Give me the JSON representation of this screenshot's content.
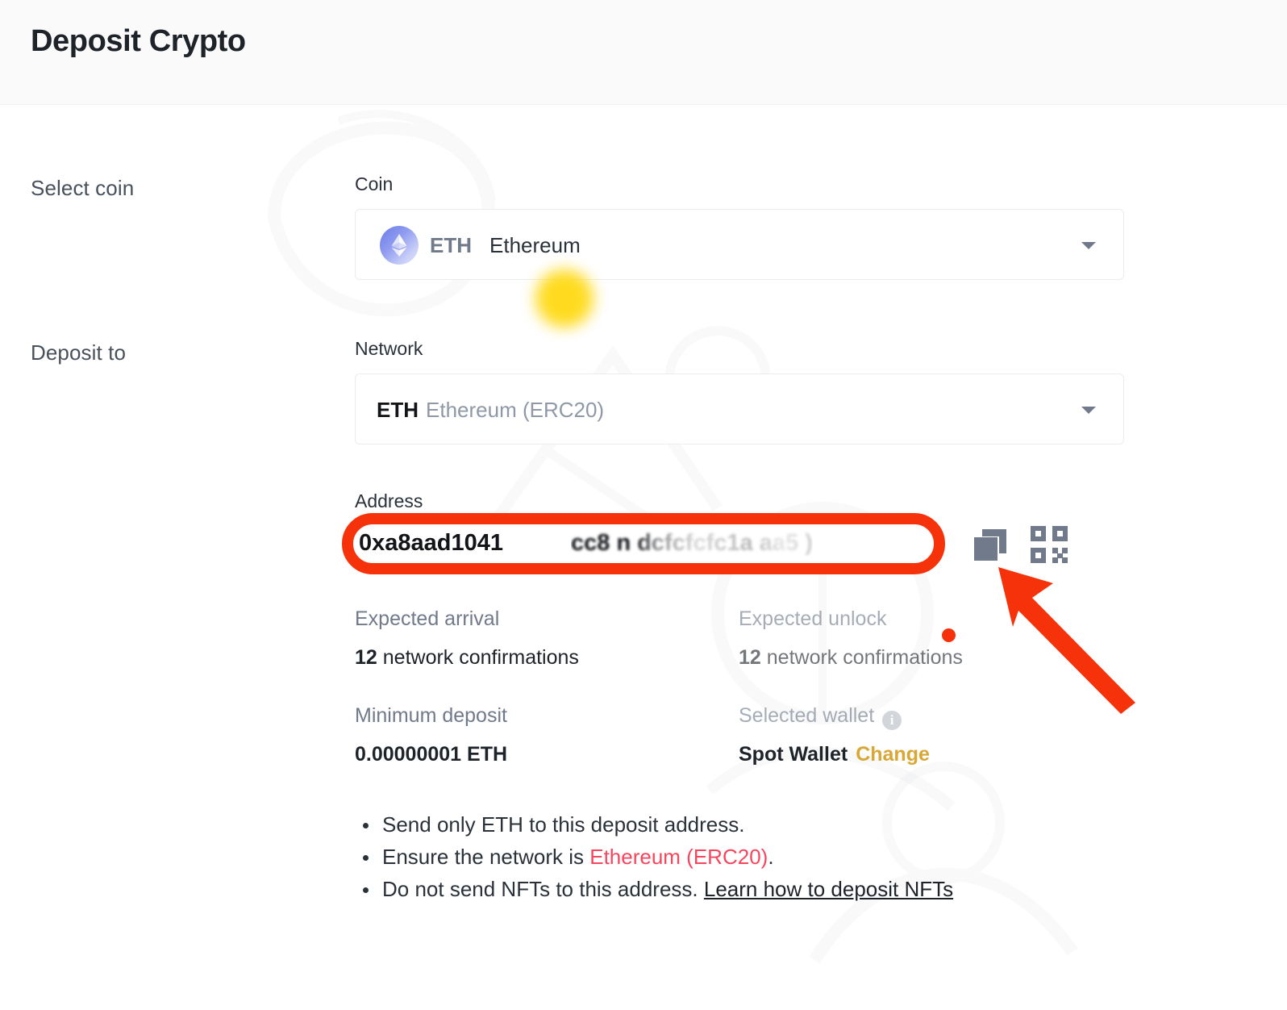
{
  "header": {
    "title": "Deposit Crypto"
  },
  "sidebar": {
    "select_coin_label": "Select coin",
    "deposit_to_label": "Deposit to"
  },
  "coin_field": {
    "label": "Coin",
    "ticker": "ETH",
    "name": "Ethereum",
    "icon": "eth-coin-icon",
    "caret": "chevron-down-icon"
  },
  "network_field": {
    "label": "Network",
    "ticker": "ETH",
    "name": "Ethereum (ERC20)",
    "caret": "chevron-down-icon"
  },
  "address_field": {
    "label": "Address",
    "value": "0xa8aad1041",
    "value_obscured_tail": "cc8    n   dcfcfcfc1a        aa5  )",
    "copy_icon": "copy-icon",
    "qr_icon": "qr-code-icon"
  },
  "info": {
    "expected_arrival": {
      "label": "Expected arrival",
      "value_number": "12",
      "value_text": " network confirmations"
    },
    "expected_unlock": {
      "label": "Expected unlock",
      "value_number": "12",
      "value_text": " network confirmations"
    },
    "minimum_deposit": {
      "label": "Minimum deposit",
      "value": "0.00000001 ETH"
    },
    "selected_wallet": {
      "label": "Selected wallet",
      "info_icon": "info-icon",
      "value": "Spot Wallet",
      "change_label": "Change"
    }
  },
  "notes": {
    "bullet1_a": "Send only ETH to this deposit address.",
    "bullet2_a": "Ensure the network is ",
    "bullet2_network": "Ethereum (ERC20)",
    "bullet2_b": ".",
    "bullet3_a": "Do not send NFTs to this address. ",
    "bullet3_link": "Learn how to deposit NFTs"
  },
  "annotations": {
    "address_highlight_color": "#f5320a",
    "arrow_color": "#f5320a",
    "cursor_highlight_color": "#ffd914",
    "dot_color": "#f5320a"
  }
}
